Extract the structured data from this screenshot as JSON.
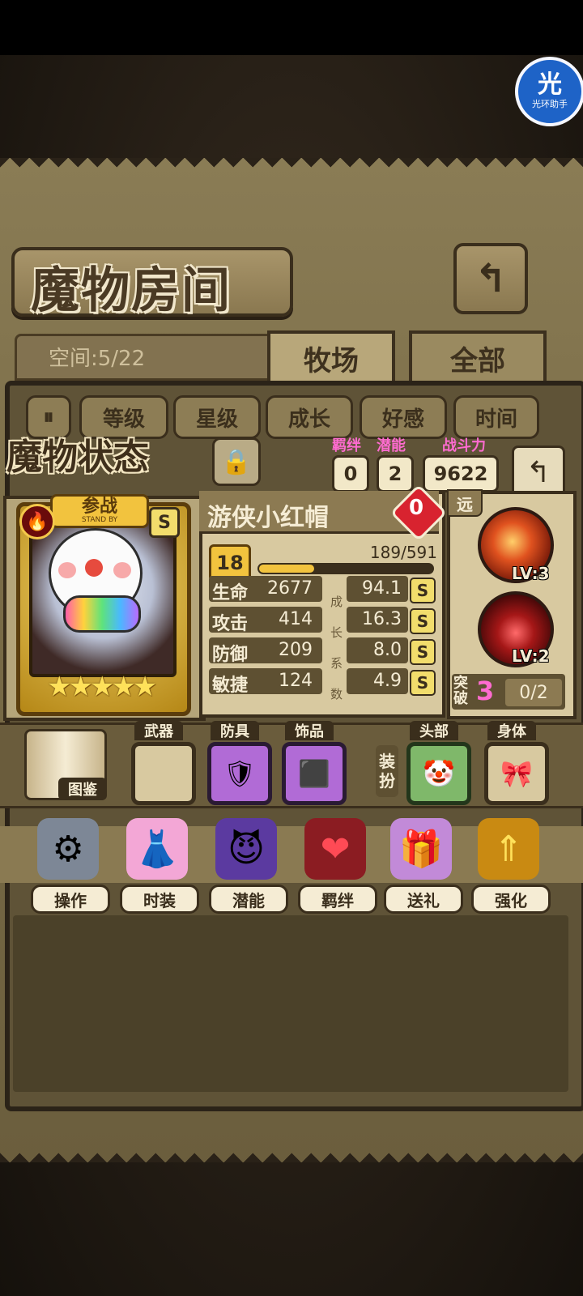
{
  "header": {
    "title": "魔物房间",
    "back_icon": "return-arrow-icon"
  },
  "widget": {
    "glyph": "光",
    "label": "光环助手"
  },
  "storage": {
    "space_label": "空间:5/22"
  },
  "tabs": [
    {
      "label": "牧场",
      "active": true
    },
    {
      "label": "全部",
      "active": false
    }
  ],
  "filters": [
    "等级",
    "星级",
    "成长",
    "好感",
    "时间"
  ],
  "status": {
    "title": "魔物状态",
    "bond_label": "羁绊",
    "bond_value": "0",
    "potential_label": "潜能",
    "potential_value": "2",
    "power_label": "战斗力",
    "power_value": "9622"
  },
  "card": {
    "tag_cn": "参战",
    "tag_en": "STAND BY",
    "grade": "S",
    "stars": 5,
    "stars_text": "★★★★★"
  },
  "monster": {
    "name": "游侠小红帽",
    "affection": "0",
    "level": "18",
    "xp_text": "189/591",
    "xp_current": 189,
    "xp_max": 591,
    "stats": [
      {
        "name": "生命",
        "value": "2677",
        "growth": "94.1",
        "grade": "S"
      },
      {
        "name": "攻击",
        "value": "414",
        "growth": "16.3",
        "grade": "S"
      },
      {
        "name": "防御",
        "value": "209",
        "growth": "8.0",
        "grade": "S"
      },
      {
        "name": "敏捷",
        "value": "124",
        "growth": "4.9",
        "grade": "S"
      }
    ],
    "growth_vertical": [
      "成",
      "长",
      "系",
      "数"
    ]
  },
  "skills": {
    "range": "远",
    "items": [
      {
        "icon": "fire-arrow-skill-icon",
        "level": "LV:3"
      },
      {
        "icon": "blood-orb-skill-icon",
        "level": "LV:2"
      }
    ],
    "break_label": "突破",
    "break_value": "3",
    "break_progress": "0/2"
  },
  "equipment": {
    "codex_label": "图鉴",
    "slots": [
      {
        "label": "武器",
        "icon": "empty-slot-icon"
      },
      {
        "label": "防具",
        "icon": "shield-icon"
      },
      {
        "label": "饰品",
        "icon": "rune-stone-icon"
      }
    ],
    "dress_label": [
      "装",
      "扮"
    ],
    "costumes": [
      {
        "label": "头部",
        "icon": "clown-wig-icon"
      },
      {
        "label": "身体",
        "icon": "bowtie-icon"
      }
    ]
  },
  "actions": [
    {
      "label": "操作",
      "icon": "gear-icon",
      "glyph": "⚙",
      "color": "#9aa3b2"
    },
    {
      "label": "时装",
      "icon": "outfit-icon",
      "glyph": "👗",
      "color": "#f3a7d6"
    },
    {
      "label": "潜能",
      "icon": "demon-icon",
      "glyph": "😈",
      "color": "#5b3aa0"
    },
    {
      "label": "羁绊",
      "icon": "hearts-icon",
      "glyph": "❤",
      "color": "#d8232f"
    },
    {
      "label": "送礼",
      "icon": "gift-icon",
      "glyph": "🎁",
      "color": "#e8c23a"
    },
    {
      "label": "强化",
      "icon": "upgrade-arrows-icon",
      "glyph": "⇑",
      "color": "#f2c33e"
    }
  ]
}
